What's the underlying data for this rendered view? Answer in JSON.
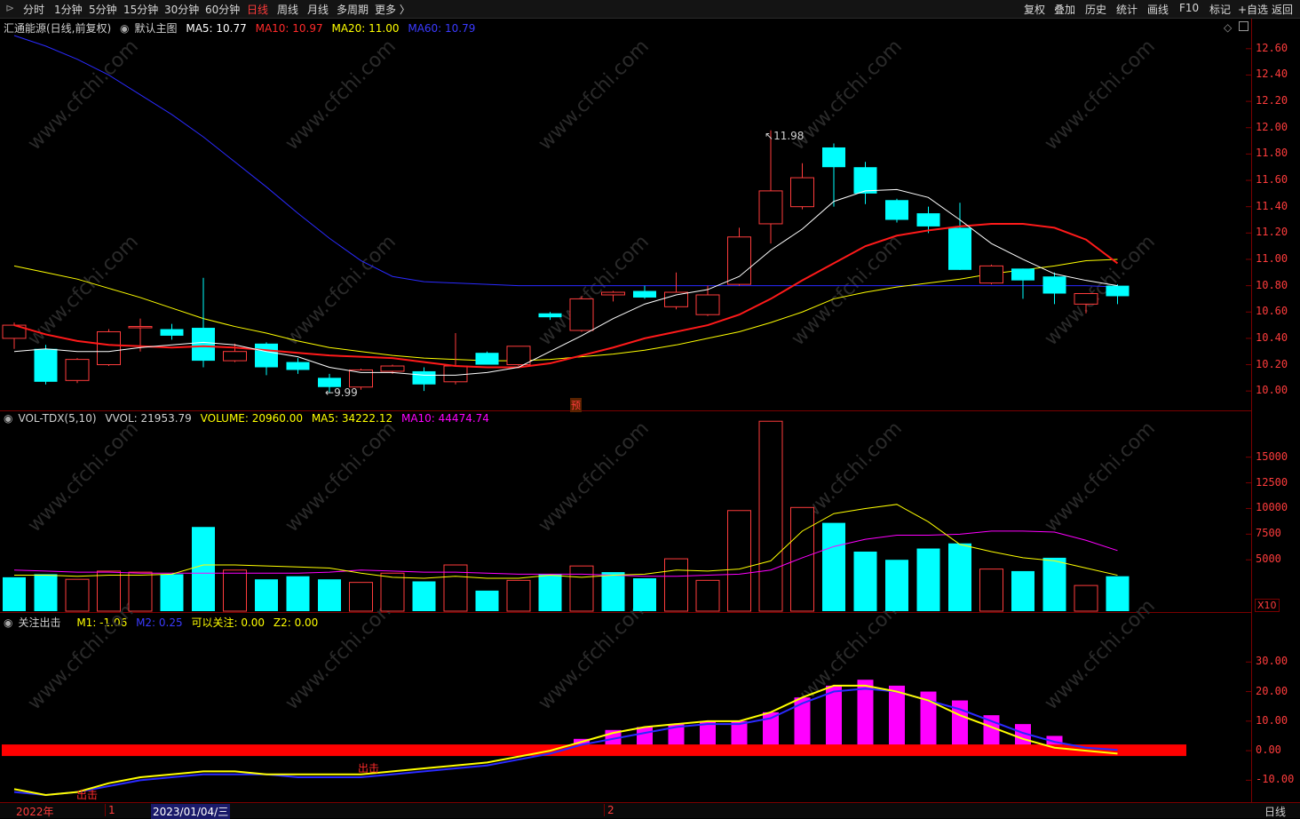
{
  "toolbar": {
    "periods": [
      "分时",
      "1分钟",
      "5分钟",
      "15分钟",
      "30分钟",
      "60分钟",
      "日线",
      "周线",
      "月线",
      "多周期",
      "更多 〉"
    ],
    "active_period": "日线",
    "right_buttons": [
      "复权",
      "叠加",
      "历史",
      "统计",
      "画线",
      "F10",
      "标记",
      "+自选",
      "返回"
    ]
  },
  "price_panel": {
    "stock": "汇通能源(日线,前复权)",
    "indicator": "默认主图",
    "ma5": "MA5: 10.77",
    "ma10": "MA10: 10.97",
    "ma20": "MA20: 11.00",
    "ma60": "MA60: 10.79",
    "high_label": "11.98",
    "low_label": "9.99",
    "marker": "预",
    "ticks": [
      "12.60",
      "12.40",
      "12.20",
      "12.00",
      "11.80",
      "11.60",
      "11.40",
      "11.20",
      "11.00",
      "10.80",
      "10.60",
      "10.40",
      "10.20",
      "10.00"
    ]
  },
  "volume_panel": {
    "title": "VOL-TDX(5,10)",
    "vvol": "VVOL: 21953.79",
    "volume": "VOLUME: 20960.00",
    "ma5": "MA5: 34222.12",
    "ma10": "MA10: 44474.74",
    "ticks": [
      "15000",
      "12500",
      "10000",
      "7500",
      "5000"
    ],
    "unit": "X10"
  },
  "indicator_panel": {
    "title": "关注出击",
    "m1": "M1: -1.06",
    "m2": "M2: 0.25",
    "focus": "可以关注: 0.00",
    "z2": "Z2: 0.00",
    "signal_1": "出击",
    "signal_2": "出击",
    "ticks": [
      "30.00",
      "20.00",
      "10.00",
      "0.00",
      "-10.00"
    ]
  },
  "bottom_bar": {
    "year": "2022年",
    "m1": "1",
    "date": "2023/01/04/三",
    "m2": "2",
    "period": "日线"
  },
  "colors": {
    "up": "#ff3c3c",
    "down": "#00ffff",
    "ma5": "#ffffff",
    "ma10": "#ff1a1a",
    "ma20": "#ffff00",
    "ma60": "#2a2aff",
    "magenta": "#ff00ff"
  },
  "chart_data": [
    {
      "type": "candlestick",
      "title": "汇通能源(日线,前复权)",
      "ylim": [
        9.9,
        12.7
      ],
      "candles": [
        {
          "o": 10.4,
          "h": 10.52,
          "l": 10.32,
          "c": 10.5,
          "dir": "up",
          "note": "partial"
        },
        {
          "o": 10.32,
          "h": 10.35,
          "l": 10.05,
          "c": 10.07
        },
        {
          "o": 10.08,
          "h": 10.25,
          "l": 10.06,
          "c": 10.24
        },
        {
          "o": 10.2,
          "h": 10.47,
          "l": 10.19,
          "c": 10.45
        },
        {
          "o": 10.48,
          "h": 10.55,
          "l": 10.3,
          "c": 10.49
        },
        {
          "o": 10.47,
          "h": 10.51,
          "l": 10.39,
          "c": 10.42
        },
        {
          "o": 10.48,
          "h": 10.86,
          "l": 10.18,
          "c": 10.23
        },
        {
          "o": 10.23,
          "h": 10.36,
          "l": 10.22,
          "c": 10.3
        },
        {
          "o": 10.36,
          "h": 10.37,
          "l": 10.12,
          "c": 10.18
        },
        {
          "o": 10.22,
          "h": 10.25,
          "l": 10.13,
          "c": 10.16
        },
        {
          "o": 10.1,
          "h": 10.13,
          "l": 9.99,
          "c": 10.03
        },
        {
          "o": 10.03,
          "h": 10.17,
          "l": 10.01,
          "c": 10.16
        },
        {
          "o": 10.15,
          "h": 10.2,
          "l": 10.13,
          "c": 10.19
        },
        {
          "o": 10.15,
          "h": 10.18,
          "l": 10.0,
          "c": 10.05
        },
        {
          "o": 10.07,
          "h": 10.44,
          "l": 10.05,
          "c": 10.19
        },
        {
          "o": 10.29,
          "h": 10.3,
          "l": 10.2,
          "c": 10.2
        },
        {
          "o": 10.2,
          "h": 10.34,
          "l": 10.19,
          "c": 10.34
        },
        {
          "o": 10.59,
          "h": 10.6,
          "l": 10.54,
          "c": 10.56
        },
        {
          "o": 10.46,
          "h": 10.72,
          "l": 10.45,
          "c": 10.7
        },
        {
          "o": 10.73,
          "h": 10.76,
          "l": 10.68,
          "c": 10.75
        },
        {
          "o": 10.76,
          "h": 10.8,
          "l": 10.7,
          "c": 10.71
        },
        {
          "o": 10.64,
          "h": 10.9,
          "l": 10.62,
          "c": 10.75
        },
        {
          "o": 10.58,
          "h": 10.8,
          "l": 10.57,
          "c": 10.73
        },
        {
          "o": 10.81,
          "h": 11.24,
          "l": 10.8,
          "c": 11.17
        },
        {
          "o": 11.27,
          "h": 11.98,
          "l": 11.12,
          "c": 11.52
        },
        {
          "o": 11.4,
          "h": 11.73,
          "l": 11.38,
          "c": 11.62
        },
        {
          "o": 11.85,
          "h": 11.88,
          "l": 11.4,
          "c": 11.7
        },
        {
          "o": 11.7,
          "h": 11.74,
          "l": 11.42,
          "c": 11.5
        },
        {
          "o": 11.45,
          "h": 11.46,
          "l": 11.28,
          "c": 11.3
        },
        {
          "o": 11.35,
          "h": 11.4,
          "l": 11.2,
          "c": 11.25
        },
        {
          "o": 11.24,
          "h": 11.43,
          "l": 10.92,
          "c": 10.92
        },
        {
          "o": 10.82,
          "h": 10.96,
          "l": 10.81,
          "c": 10.95
        },
        {
          "o": 10.93,
          "h": 10.93,
          "l": 10.7,
          "c": 10.84
        },
        {
          "o": 10.87,
          "h": 10.9,
          "l": 10.66,
          "c": 10.74
        },
        {
          "o": 10.66,
          "h": 10.73,
          "l": 10.59,
          "c": 10.74
        },
        {
          "o": 10.8,
          "h": 10.81,
          "l": 10.66,
          "c": 10.72
        }
      ],
      "ma5": [
        10.3,
        10.32,
        10.3,
        10.3,
        10.33,
        10.35,
        10.37,
        10.35,
        10.3,
        10.26,
        10.18,
        10.14,
        10.14,
        10.12,
        10.12,
        10.14,
        10.18,
        10.3,
        10.42,
        10.55,
        10.66,
        10.73,
        10.77,
        10.87,
        11.07,
        11.23,
        11.44,
        11.52,
        11.53,
        11.47,
        11.3,
        11.12,
        11.0,
        10.89,
        10.84,
        10.8
      ],
      "ma10": [
        10.5,
        10.43,
        10.38,
        10.35,
        10.34,
        10.33,
        10.34,
        10.33,
        10.31,
        10.29,
        10.27,
        10.26,
        10.25,
        10.22,
        10.19,
        10.18,
        10.18,
        10.21,
        10.27,
        10.33,
        10.4,
        10.45,
        10.5,
        10.58,
        10.7,
        10.84,
        10.97,
        11.1,
        11.18,
        11.22,
        11.25,
        11.27,
        11.27,
        11.24,
        11.15,
        10.97
      ],
      "ma20": [
        10.95,
        10.9,
        10.85,
        10.78,
        10.71,
        10.63,
        10.55,
        10.49,
        10.44,
        10.38,
        10.33,
        10.3,
        10.27,
        10.25,
        10.24,
        10.23,
        10.23,
        10.24,
        10.26,
        10.28,
        10.31,
        10.35,
        10.4,
        10.45,
        10.52,
        10.6,
        10.7,
        10.75,
        10.79,
        10.82,
        10.85,
        10.89,
        10.92,
        10.95,
        10.99,
        11.0
      ],
      "ma60": [
        12.7,
        12.62,
        12.52,
        12.4,
        12.25,
        12.1,
        11.93,
        11.74,
        11.55,
        11.35,
        11.16,
        10.99,
        10.87,
        10.83,
        10.82,
        10.81,
        10.8,
        10.8,
        10.8,
        10.8,
        10.8,
        10.8,
        10.8,
        10.8,
        10.8,
        10.8,
        10.8,
        10.8,
        10.8,
        10.8,
        10.8,
        10.8,
        10.8,
        10.8,
        10.8,
        10.79
      ]
    },
    {
      "type": "bar",
      "title": "VOL-TDX(5,10)",
      "ylim": [
        0,
        18000
      ],
      "volume": [
        3300,
        3600,
        3100,
        3900,
        3800,
        3600,
        8200,
        4000,
        3100,
        3400,
        3100,
        2800,
        3700,
        2900,
        4500,
        2000,
        3000,
        3600,
        4400,
        3800,
        3200,
        5100,
        3000,
        9800,
        18500,
        10100,
        8600,
        5800,
        5000,
        6100,
        6600,
        4100,
        3900,
        5200,
        2500,
        3400
      ],
      "direction": [
        "down",
        "down",
        "up",
        "up",
        "up",
        "down",
        "down",
        "up",
        "down",
        "down",
        "down",
        "up",
        "up",
        "down",
        "up",
        "down",
        "up",
        "down",
        "up",
        "down",
        "down",
        "up",
        "up",
        "up",
        "up",
        "up",
        "down",
        "down",
        "down",
        "down",
        "down",
        "up",
        "down",
        "down",
        "up",
        "down"
      ],
      "ma5": [
        3500,
        3500,
        3400,
        3500,
        3500,
        3600,
        4500,
        4500,
        4400,
        4300,
        4200,
        3700,
        3300,
        3200,
        3400,
        3200,
        3200,
        3500,
        3300,
        3500,
        3600,
        4000,
        3900,
        4100,
        4900,
        7800,
        9500,
        10000,
        10400,
        8700,
        6500,
        5800,
        5200,
        4900,
        4200,
        3500
      ],
      "ma10": [
        4000,
        3900,
        3800,
        3800,
        3700,
        3700,
        3700,
        3700,
        3700,
        3700,
        3800,
        4000,
        3900,
        3800,
        3800,
        3700,
        3600,
        3600,
        3600,
        3500,
        3400,
        3400,
        3500,
        3600,
        4000,
        5200,
        6300,
        7000,
        7400,
        7400,
        7500,
        7800,
        7800,
        7700,
        6900,
        5900
      ]
    },
    {
      "type": "bar",
      "title": "关注出击",
      "ylim": [
        -15,
        40
      ],
      "m1": [
        -13,
        -15,
        -14,
        -11,
        -9,
        -8,
        -7,
        -7,
        -8,
        -8,
        -8,
        -8,
        -7,
        -6,
        -5,
        -4,
        -2,
        0,
        3,
        6,
        8,
        9,
        10,
        10,
        13,
        18,
        22,
        22,
        20,
        17,
        12,
        8,
        4,
        1,
        0,
        -1
      ],
      "m2": [
        -14,
        -15,
        -14,
        -12,
        -10,
        -9,
        -8,
        -8,
        -8,
        -9,
        -9,
        -9,
        -8,
        -7,
        -6,
        -5,
        -3,
        -1,
        2,
        4,
        6,
        8,
        9,
        9,
        11,
        16,
        20,
        21,
        20,
        17,
        14,
        10,
        6,
        3,
        1,
        0.25
      ],
      "bars": [
        0,
        0,
        0,
        0,
        0,
        0,
        0,
        0,
        0,
        0,
        0,
        0,
        0,
        0,
        0,
        0,
        0,
        0,
        4,
        7,
        8,
        9,
        10,
        10,
        13,
        18,
        22,
        24,
        22,
        20,
        17,
        12,
        9,
        5,
        0,
        0
      ]
    }
  ]
}
